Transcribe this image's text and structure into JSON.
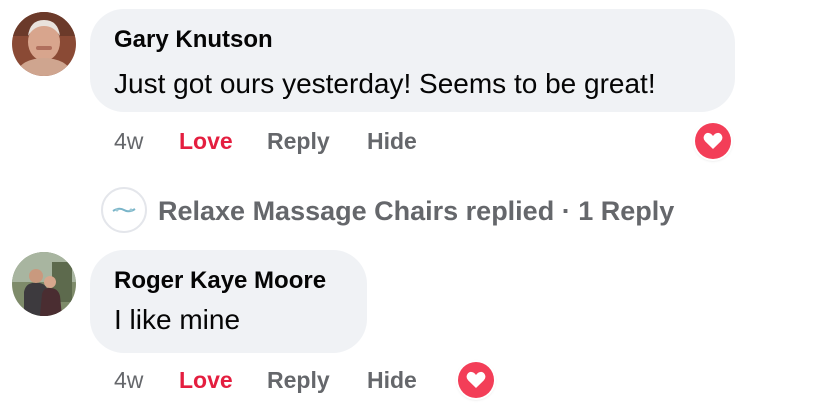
{
  "comments": [
    {
      "author": "Gary Knutson",
      "text": "Just got ours yesterday! Seems to be great!",
      "time": "4w",
      "love_label": "Love",
      "reply_label": "Reply",
      "hide_label": "Hide",
      "reaction_icon": "heart-icon"
    },
    {
      "author": "Roger Kaye Moore",
      "text": "I like mine",
      "time": "4w",
      "love_label": "Love",
      "reply_label": "Reply",
      "hide_label": "Hide",
      "reaction_icon": "heart-icon"
    }
  ],
  "replies_summary": {
    "page_name": "Relaxe Massage Chairs replied",
    "separator": "·",
    "count_label": "1 Reply"
  },
  "colors": {
    "bubble": "#f0f2f5",
    "love_accent": "#e41e3f",
    "reaction_heart": "#f33e58",
    "secondary_text": "#65676b"
  }
}
